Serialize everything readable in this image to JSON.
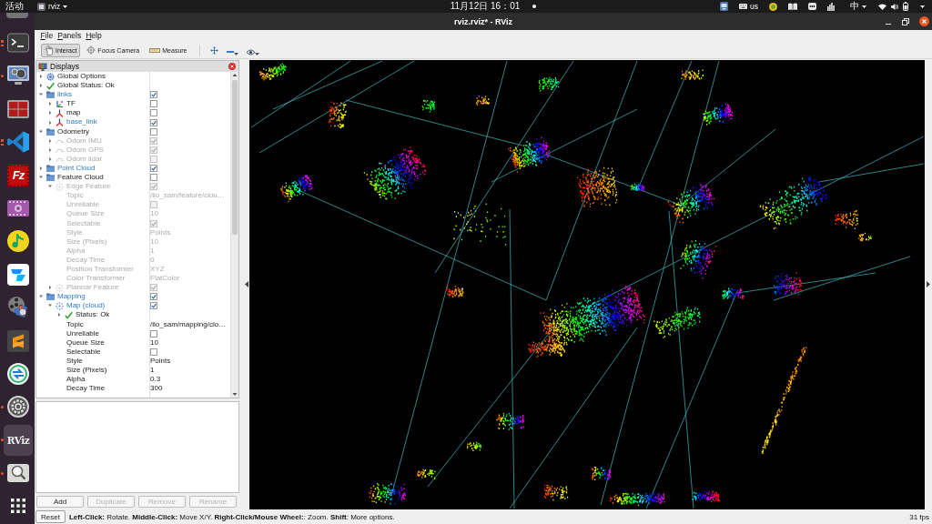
{
  "top_bar": {
    "activities": "活动",
    "app_menu": "rviz",
    "clock": "11月12日  16：01",
    "keyboard_layout": "us",
    "input_method": "中"
  },
  "dock": {
    "items": [
      {
        "kind": "terminal",
        "running": true,
        "several": true,
        "selected": false
      },
      {
        "kind": "monitor",
        "running": true,
        "several": false,
        "selected": false
      },
      {
        "kind": "panels",
        "running": false,
        "several": false,
        "selected": false
      },
      {
        "kind": "code",
        "running": true,
        "several": true,
        "selected": false
      },
      {
        "kind": "filezilla",
        "logo_text": "Fz",
        "running": false,
        "several": false,
        "selected": false
      },
      {
        "kind": "film",
        "running": false,
        "several": false,
        "selected": false
      },
      {
        "kind": "music",
        "running": false,
        "several": false,
        "selected": false
      },
      {
        "kind": "todesk",
        "running": false,
        "several": false,
        "selected": false
      },
      {
        "kind": "reel",
        "running": false,
        "several": false,
        "selected": false
      },
      {
        "kind": "sublime",
        "running": false,
        "several": false,
        "selected": false
      },
      {
        "kind": "remote",
        "running": false,
        "several": false,
        "selected": false
      },
      {
        "kind": "settings",
        "running": true,
        "several": false,
        "selected": false
      },
      {
        "kind": "rviz",
        "logo_text": "RViz",
        "running": true,
        "several": false,
        "selected": true
      },
      {
        "kind": "search",
        "running": true,
        "several": false,
        "selected": false
      },
      {
        "kind": "apps",
        "running": false,
        "several": false,
        "selected": false
      }
    ]
  },
  "window": {
    "title": "rviz.rviz* - RViz"
  },
  "menu": [
    "File",
    "Panels",
    "Help"
  ],
  "toolbar": {
    "tools": [
      {
        "kind": "interact",
        "label": "Interact",
        "selected": true
      },
      {
        "kind": "focus",
        "label": "Focus Camera",
        "selected": false
      },
      {
        "kind": "measure",
        "label": "Measure",
        "selected": false
      }
    ]
  },
  "displays": {
    "title": "Displays",
    "rows": [
      {
        "kind": "options",
        "label": "Global Options",
        "expanded": false,
        "disabled": false
      },
      {
        "kind": "status",
        "label": "Global Status: Ok",
        "expanded": false,
        "disabled": false
      },
      {
        "kind": "group",
        "label": "links",
        "expanded": true,
        "checked": true,
        "disabled": false,
        "children": [
          {
            "kind": "tf",
            "label": "TF",
            "expanded": false,
            "checked": false,
            "disabled": false
          },
          {
            "kind": "axes",
            "label": "map",
            "expanded": false,
            "checked": false,
            "disabled": false
          },
          {
            "kind": "axes",
            "label": "base_link",
            "expanded": false,
            "checked": true,
            "disabled": false
          }
        ]
      },
      {
        "kind": "group",
        "label": "Odometry",
        "expanded": true,
        "checked": false,
        "disabled": false,
        "children": [
          {
            "kind": "odometry",
            "label": "Odom IMU",
            "expanded": false,
            "checked": true,
            "disabled": true
          },
          {
            "kind": "odometry",
            "label": "Odom GPS",
            "expanded": false,
            "checked": true,
            "disabled": true
          },
          {
            "kind": "odometry",
            "label": "Odom lidar",
            "expanded": false,
            "checked": false,
            "disabled": true
          }
        ]
      },
      {
        "kind": "group",
        "label": "Point Cloud",
        "expanded": false,
        "checked": true,
        "disabled": false
      },
      {
        "kind": "group",
        "label": "Feature Cloud",
        "expanded": true,
        "checked": false,
        "disabled": false,
        "children": [
          {
            "kind": "pointcloud",
            "label": "Edge Feature",
            "expanded": true,
            "checked": true,
            "disabled": true,
            "children": [
              {
                "kind": "property",
                "label": "Topic",
                "value": "/lio_sam/feature/clou…",
                "disabled": true
              },
              {
                "kind": "property",
                "label": "Unreliable",
                "checked": false,
                "disabled": true
              },
              {
                "kind": "property",
                "label": "Queue Size",
                "value": "10",
                "disabled": true
              },
              {
                "kind": "property",
                "label": "Selectable",
                "checked": true,
                "disabled": true
              },
              {
                "kind": "property",
                "label": "Style",
                "value": "Points",
                "disabled": true
              },
              {
                "kind": "property",
                "label": "Size (Pixels)",
                "value": "10",
                "disabled": true
              },
              {
                "kind": "property",
                "label": "Alpha",
                "value": "1",
                "disabled": true
              },
              {
                "kind": "property",
                "label": "Decay Time",
                "value": "0",
                "disabled": true
              },
              {
                "kind": "property",
                "label": "Position Transformer",
                "value": "XYZ",
                "disabled": true
              },
              {
                "kind": "property",
                "label": "Color Transformer",
                "value": "FlatColor",
                "disabled": true
              }
            ]
          },
          {
            "kind": "pointcloud",
            "label": "Plannar Feature",
            "expanded": false,
            "checked": true,
            "disabled": true
          }
        ]
      },
      {
        "kind": "group",
        "label": "Mapping",
        "expanded": true,
        "checked": true,
        "disabled": false,
        "children": [
          {
            "kind": "pointcloud",
            "label": "Map (cloud)",
            "expanded": true,
            "checked": true,
            "disabled": false,
            "children": [
              {
                "kind": "status",
                "label": "Status: Ok",
                "expanded": false,
                "disabled": false
              },
              {
                "kind": "property",
                "label": "Topic",
                "value": "/lio_sam/mapping/clo…",
                "disabled": false
              },
              {
                "kind": "property",
                "label": "Unreliable",
                "checked": false,
                "disabled": false
              },
              {
                "kind": "property",
                "label": "Queue Size",
                "value": "10",
                "disabled": false
              },
              {
                "kind": "property",
                "label": "Selectable",
                "checked": false,
                "disabled": false
              },
              {
                "kind": "property",
                "label": "Style",
                "value": "Points",
                "disabled": false
              },
              {
                "kind": "property",
                "label": "Size (Pixels)",
                "value": "1",
                "disabled": false
              },
              {
                "kind": "property",
                "label": "Alpha",
                "value": "0.3",
                "disabled": false
              },
              {
                "kind": "property",
                "label": "Decay Time",
                "value": "300",
                "disabled": false
              }
            ]
          }
        ]
      }
    ]
  },
  "panel_buttons": [
    {
      "label": "Add",
      "disabled": false
    },
    {
      "label": "Duplicate",
      "disabled": true
    },
    {
      "label": "Remove",
      "disabled": true
    },
    {
      "label": "Rename",
      "disabled": true
    }
  ],
  "status_bar": {
    "reset": "Reset",
    "hint": "**Left-Click:** Rotate. **Middle-Click:** Move X/Y. **Right-Click/Mouse Wheel:**: Zoom. **Shift**: More options.",
    "fps": "31 fps"
  }
}
